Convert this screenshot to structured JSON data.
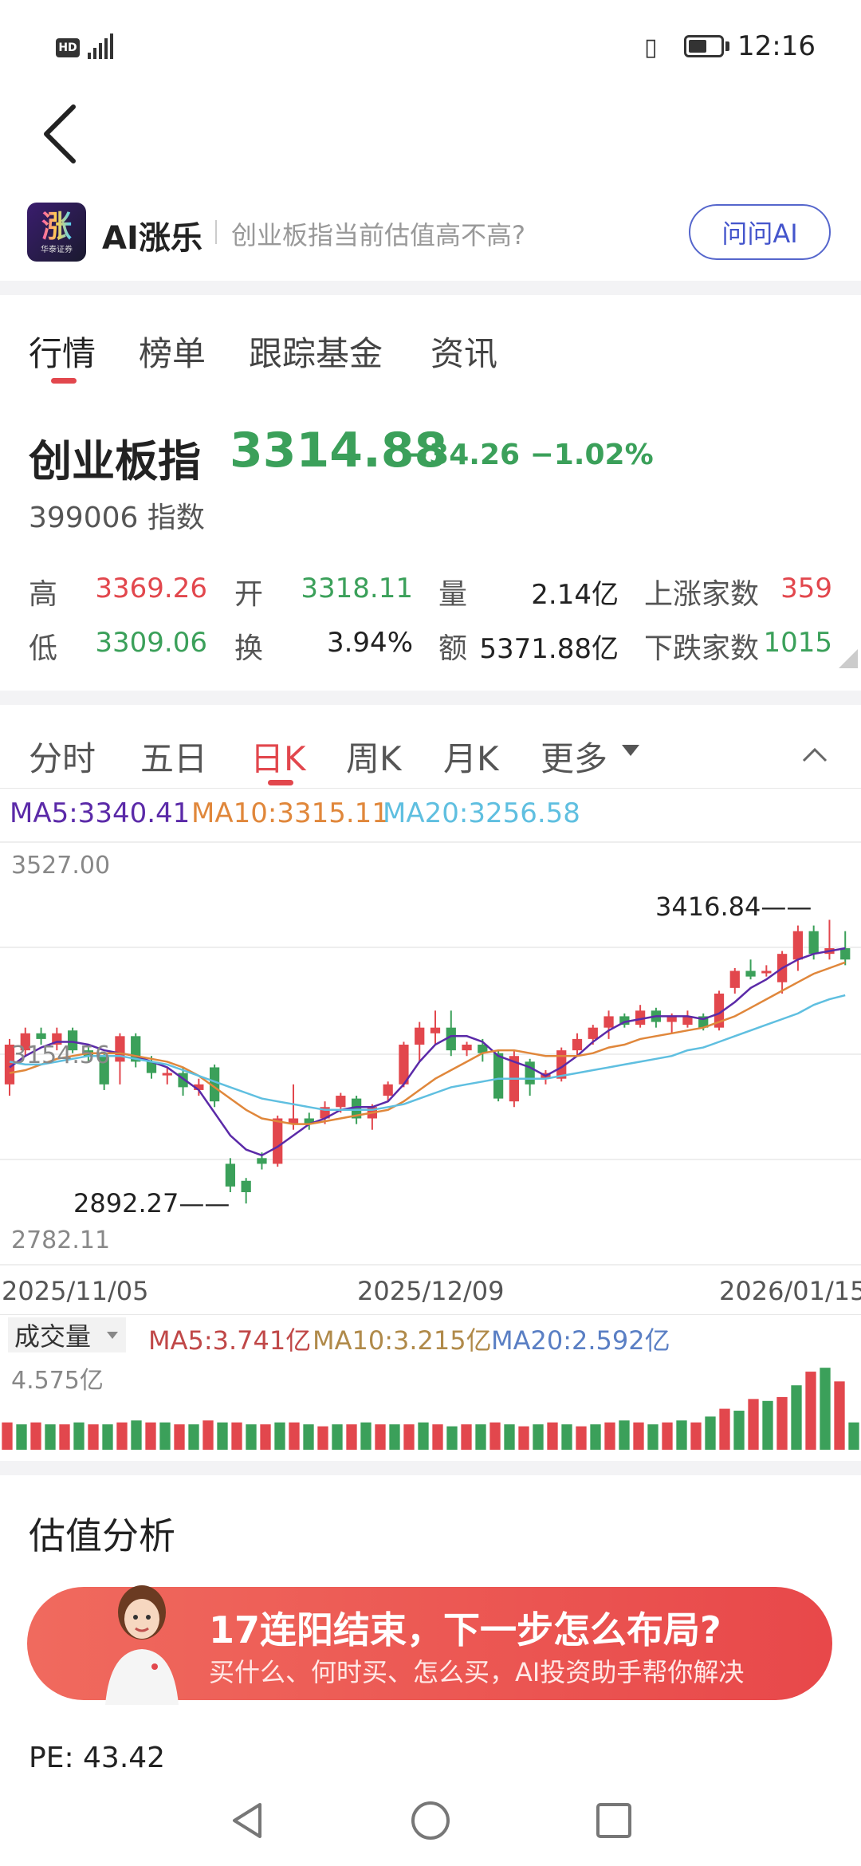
{
  "status_bar": {
    "time": "12:16",
    "hd": "HD",
    "network": "5G"
  },
  "ai_bar": {
    "logo_text": "涨",
    "logo_subtext": "华泰证券",
    "name": "AI涨乐",
    "question": "创业板指当前估值高不高?",
    "ask_button": "问问AI"
  },
  "tabs": [
    {
      "label": "行情"
    },
    {
      "label": "榜单"
    },
    {
      "label": "跟踪基金"
    },
    {
      "label": "资讯"
    }
  ],
  "index": {
    "name": "创业板指",
    "price": "3314.88",
    "change": "−34.26",
    "change_pct": "−1.02%",
    "code": "399006",
    "type": "指数"
  },
  "quote": {
    "high_label": "高",
    "high": "3369.26",
    "open_label": "开",
    "open": "3318.11",
    "volume_label": "量",
    "volume": "2.14亿",
    "up_label": "上涨家数",
    "up": "359",
    "low_label": "低",
    "low": "3309.06",
    "turnover_label": "换",
    "turnover": "3.94%",
    "amount_label": "额",
    "amount": "5371.88亿",
    "down_label": "下跌家数",
    "down": "1015"
  },
  "chart_tabs": [
    {
      "label": "分时"
    },
    {
      "label": "五日"
    },
    {
      "label": "日K"
    },
    {
      "label": "周K"
    },
    {
      "label": "月K"
    },
    {
      "label": "更多"
    }
  ],
  "ma_legend": {
    "ma5": "MA5:3340.41",
    "ma10": "MA10:3315.11",
    "ma20": "MA20:3256.58"
  },
  "colors": {
    "up": "#e2474d",
    "down": "#3ba05a",
    "ma5": "#5b2aa8",
    "ma10": "#e0873b",
    "ma20": "#5fbfe0",
    "accent": "#e2474d"
  },
  "chart_data": {
    "type": "candlestick",
    "y_max_label": "3527.00",
    "y_min_label": "2782.11",
    "mid_label": "3154.56",
    "ylim": [
      2782.11,
      3527.0
    ],
    "high_marker": "3416.84",
    "low_marker": "2892.27",
    "x_labels": [
      "2025/11/05",
      "2025/12/09",
      "2026/01/15"
    ],
    "candles": [
      [
        3100,
        3170,
        3080,
        3180
      ],
      [
        3160,
        3190,
        3150,
        3200
      ],
      [
        3190,
        3180,
        3170,
        3200
      ],
      [
        3170,
        3190,
        3160,
        3200
      ],
      [
        3195,
        3160,
        3155,
        3200
      ],
      [
        3160,
        3150,
        3140,
        3165
      ],
      [
        3150,
        3100,
        3090,
        3155
      ],
      [
        3140,
        3185,
        3100,
        3190
      ],
      [
        3185,
        3140,
        3130,
        3190
      ],
      [
        3140,
        3120,
        3110,
        3150
      ],
      [
        3120,
        3120,
        3100,
        3130
      ],
      [
        3120,
        3095,
        3080,
        3130
      ],
      [
        3090,
        3100,
        3080,
        3110
      ],
      [
        3130,
        3070,
        3060,
        3135
      ],
      [
        2960,
        2920,
        2910,
        2970
      ],
      [
        2930,
        2910,
        2890,
        2935
      ],
      [
        2970,
        2960,
        2950,
        2980
      ],
      [
        2960,
        3040,
        2955,
        3045
      ],
      [
        3030,
        3040,
        3020,
        3100
      ],
      [
        3040,
        3030,
        3020,
        3050
      ],
      [
        3040,
        3060,
        3030,
        3070
      ],
      [
        3060,
        3080,
        3050,
        3085
      ],
      [
        3075,
        3040,
        3030,
        3080
      ],
      [
        3040,
        3060,
        3020,
        3065
      ],
      [
        3080,
        3100,
        3070,
        3105
      ],
      [
        3100,
        3170,
        3095,
        3175
      ],
      [
        3170,
        3200,
        3140,
        3210
      ],
      [
        3190,
        3200,
        3170,
        3230
      ],
      [
        3200,
        3160,
        3150,
        3230
      ],
      [
        3160,
        3170,
        3150,
        3175
      ],
      [
        3170,
        3155,
        3140,
        3180
      ],
      [
        3155,
        3075,
        3070,
        3160
      ],
      [
        3070,
        3150,
        3060,
        3160
      ],
      [
        3140,
        3100,
        3080,
        3145
      ],
      [
        3110,
        3120,
        3100,
        3125
      ],
      [
        3110,
        3160,
        3105,
        3165
      ],
      [
        3160,
        3180,
        3150,
        3190
      ],
      [
        3180,
        3200,
        3170,
        3205
      ],
      [
        3200,
        3220,
        3180,
        3230
      ],
      [
        3220,
        3205,
        3200,
        3225
      ],
      [
        3205,
        3230,
        3200,
        3240
      ],
      [
        3230,
        3210,
        3200,
        3235
      ],
      [
        3210,
        3220,
        3190,
        3225
      ],
      [
        3205,
        3220,
        3200,
        3230
      ],
      [
        3220,
        3200,
        3195,
        3225
      ],
      [
        3200,
        3260,
        3195,
        3265
      ],
      [
        3270,
        3300,
        3260,
        3305
      ],
      [
        3300,
        3290,
        3285,
        3320
      ],
      [
        3300,
        3300,
        3290,
        3310
      ],
      [
        3280,
        3330,
        3260,
        3335
      ],
      [
        3320,
        3370,
        3300,
        3380
      ],
      [
        3370,
        3330,
        3320,
        3380
      ],
      [
        3330,
        3340,
        3320,
        3390
      ],
      [
        3340,
        3320,
        3310,
        3370
      ]
    ],
    "ma5_line": [
      3130,
      3150,
      3165,
      3175,
      3175,
      3170,
      3160,
      3155,
      3150,
      3140,
      3130,
      3110,
      3090,
      3050,
      3010,
      2985,
      2975,
      2990,
      3010,
      3030,
      3040,
      3055,
      3060,
      3060,
      3070,
      3100,
      3140,
      3170,
      3185,
      3185,
      3175,
      3150,
      3140,
      3130,
      3115,
      3130,
      3150,
      3175,
      3195,
      3210,
      3215,
      3220,
      3220,
      3220,
      3215,
      3225,
      3245,
      3270,
      3285,
      3305,
      3320,
      3330,
      3335,
      3340
    ],
    "ma10_line": [
      3120,
      3125,
      3135,
      3145,
      3150,
      3155,
      3155,
      3155,
      3150,
      3145,
      3140,
      3130,
      3115,
      3095,
      3075,
      3055,
      3040,
      3035,
      3030,
      3030,
      3035,
      3040,
      3045,
      3050,
      3055,
      3070,
      3090,
      3110,
      3125,
      3140,
      3155,
      3160,
      3160,
      3155,
      3150,
      3150,
      3150,
      3155,
      3165,
      3170,
      3180,
      3185,
      3190,
      3195,
      3200,
      3210,
      3220,
      3235,
      3250,
      3265,
      3280,
      3295,
      3305,
      3315
    ],
    "ma20_line": [
      3140,
      3135,
      3135,
      3140,
      3145,
      3150,
      3150,
      3150,
      3145,
      3140,
      3135,
      3125,
      3115,
      3105,
      3095,
      3085,
      3075,
      3070,
      3065,
      3060,
      3055,
      3055,
      3055,
      3055,
      3060,
      3065,
      3075,
      3085,
      3095,
      3100,
      3105,
      3110,
      3110,
      3110,
      3110,
      3115,
      3120,
      3125,
      3130,
      3135,
      3140,
      3145,
      3150,
      3160,
      3165,
      3175,
      3185,
      3195,
      3205,
      3215,
      3225,
      3240,
      3250,
      3257
    ]
  },
  "volume": {
    "title": "成交量",
    "ma5": "MA5:3.741亿",
    "ma10": "MA10:3.215亿",
    "ma20": "MA20:2.592亿",
    "max_label": "4.575亿",
    "max": 4.575,
    "values": [
      1.4,
      1.3,
      1.4,
      1.3,
      1.3,
      1.4,
      1.3,
      1.3,
      1.4,
      1.5,
      1.4,
      1.4,
      1.3,
      1.3,
      1.5,
      1.4,
      1.4,
      1.3,
      1.3,
      1.4,
      1.4,
      1.3,
      1.2,
      1.3,
      1.3,
      1.4,
      1.3,
      1.3,
      1.3,
      1.4,
      1.3,
      1.2,
      1.3,
      1.3,
      1.4,
      1.3,
      1.2,
      1.3,
      1.4,
      1.3,
      1.2,
      1.3,
      1.4,
      1.5,
      1.4,
      1.3,
      1.4,
      1.5,
      1.4,
      1.7,
      2.1,
      2.0,
      2.6,
      2.5,
      2.7,
      3.3,
      4.0,
      4.2,
      3.5,
      1.4
    ]
  },
  "valuation": {
    "title": "估值分析",
    "pe": "PE: 43.42"
  },
  "banner": {
    "title": "17连阳结束，下一步怎么布局?",
    "subtitle": "买什么、何时买、怎么买，AI投资助手帮你解决"
  }
}
